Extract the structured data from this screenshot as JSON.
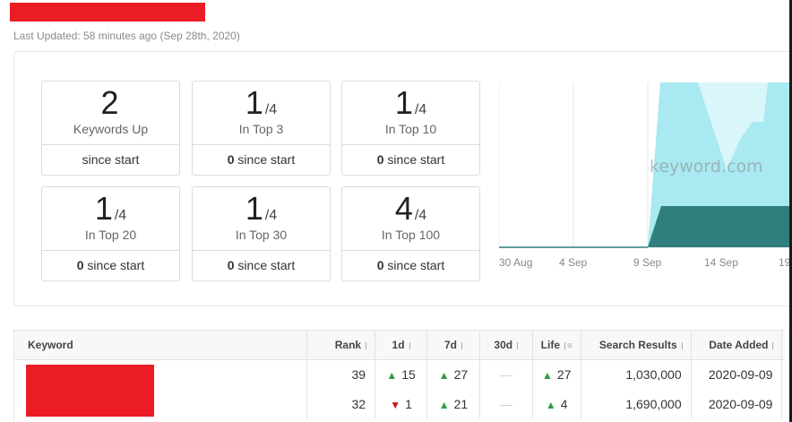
{
  "header": {
    "last_updated": "Last Updated: 58 minutes ago (Sep 28th, 2020)"
  },
  "stats": [
    {
      "value": "2",
      "denominator": "",
      "label": "Keywords Up",
      "change_num": "",
      "change_text": "since start"
    },
    {
      "value": "1",
      "denominator": "/4",
      "label": "In Top 3",
      "change_num": "0",
      "change_text": " since start"
    },
    {
      "value": "1",
      "denominator": "/4",
      "label": "In Top 10",
      "change_num": "0",
      "change_text": " since start"
    },
    {
      "value": "1",
      "denominator": "/4",
      "label": "In Top 20",
      "change_num": "0",
      "change_text": " since start"
    },
    {
      "value": "1",
      "denominator": "/4",
      "label": "In Top 30",
      "change_num": "0",
      "change_text": " since start"
    },
    {
      "value": "4",
      "denominator": "/4",
      "label": "In Top 100",
      "change_num": "0",
      "change_text": " since start"
    }
  ],
  "chart": {
    "watermark": "keyword.com",
    "x_ticks": [
      "30 Aug",
      "4 Sep",
      "9 Sep",
      "14 Sep",
      "19"
    ],
    "colors": {
      "light": "#a9e9f1",
      "lighter": "#d9f6fa",
      "dark": "#2f7f7c",
      "gridline": "#e6e6e6"
    }
  },
  "table": {
    "headers": {
      "keyword": "Keyword",
      "rank": "Rank",
      "d1": "1d",
      "d7": "7d",
      "d30": "30d",
      "life": "Life",
      "search_results": "Search Results",
      "date_added": "Date Added"
    },
    "rows": [
      {
        "rank": "39",
        "d1_dir": "up",
        "d1": "15",
        "d7_dir": "up",
        "d7": "27",
        "d30": "—",
        "life_dir": "up",
        "life": "27",
        "search_results": "1,030,000",
        "date_added": "2020-09-09"
      },
      {
        "rank": "32",
        "d1_dir": "down",
        "d1": "1",
        "d7_dir": "up",
        "d7": "21",
        "d30": "—",
        "life_dir": "up",
        "life": "4",
        "search_results": "1,690,000",
        "date_added": "2020-09-09"
      }
    ]
  }
}
